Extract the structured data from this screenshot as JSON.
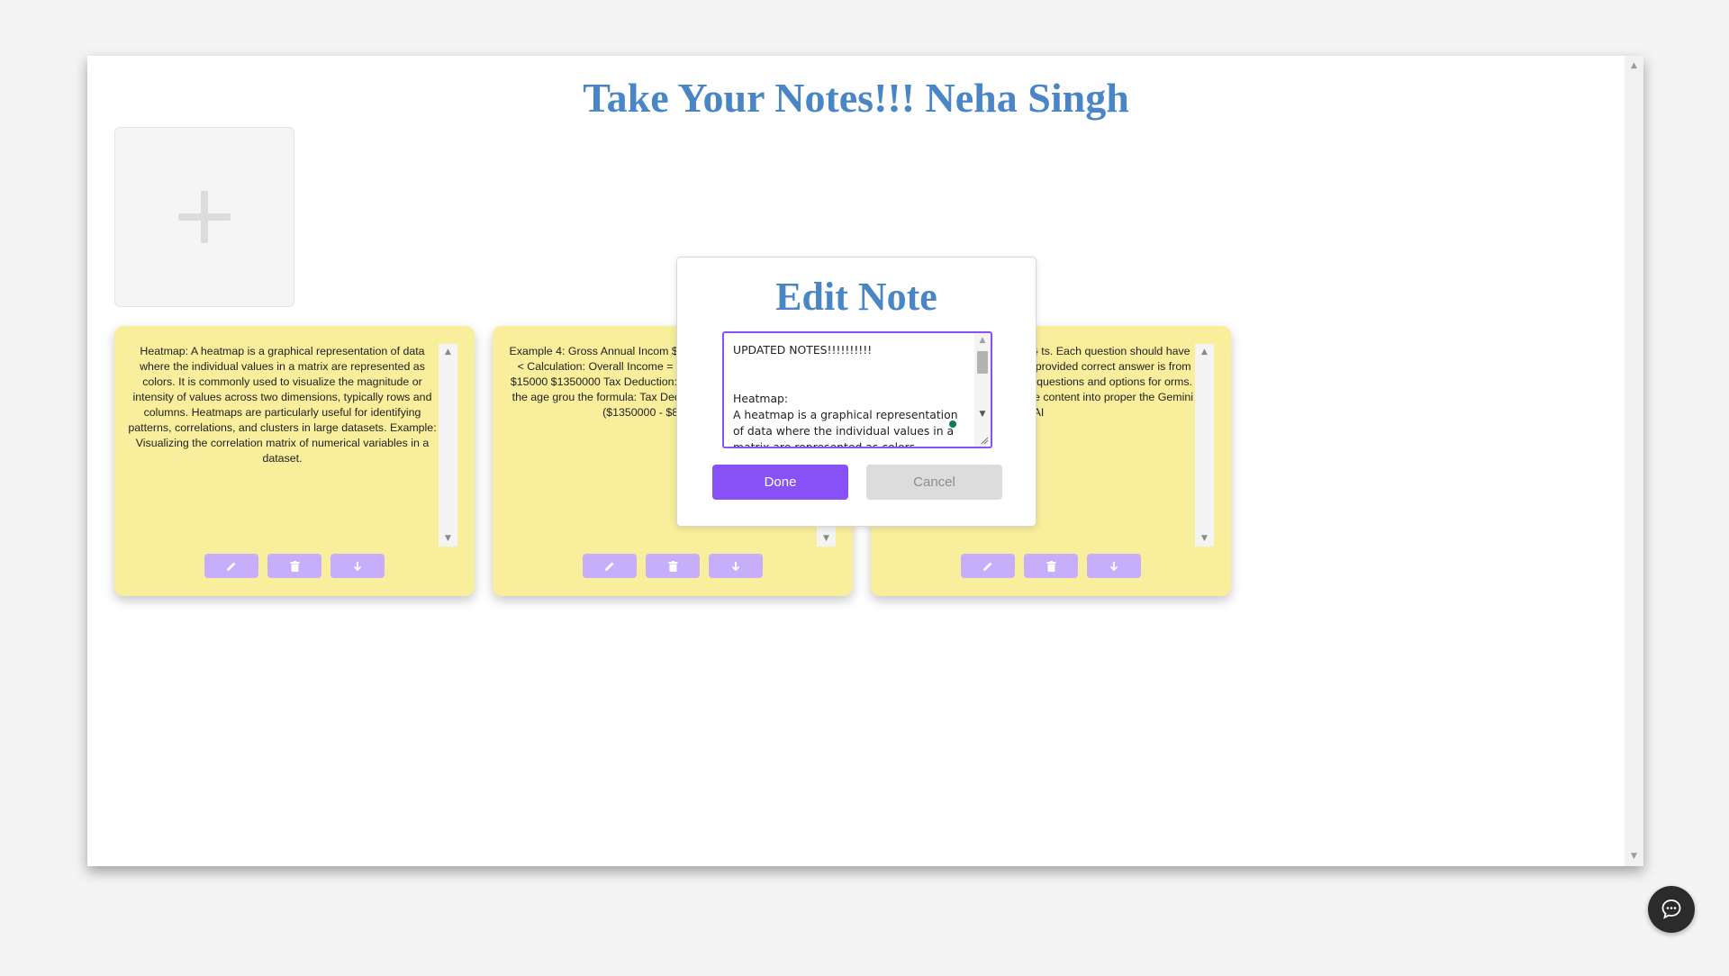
{
  "page": {
    "title": "Take Your Notes!!! Neha Singh"
  },
  "add_note": {
    "icon": "plus-icon"
  },
  "notes": [
    {
      "text": "Heatmap: A heatmap is a graphical representation of data where the individual values in a matrix are represented as colors. It is commonly used to visualize the magnitude or intensity of values across two dimensions, typically rows and columns. Heatmaps are particularly useful for identifying patterns, correlations, and clusters in large datasets. Example: Visualizing the correlation matrix of numerical variables in a dataset."
    },
    {
      "text": "Example 4: Gross Annual Incom $50000 Age Group: ≥ 40 but < Calculation: Overall Income = Gr Income - Deductions = $15000 $1350000 Tax Deduction: Since t than $800,000 and the age grou the formula: Tax Deduction = $800,000) = 0.4 * ($1350000 - $8 $22000"
    },
    {
      "text": "ment questions for the ${topic} ts. Each question should have options per question) with the provided correct answer is from utside Assign 2 marks to each questions and options for orms. Output the response in e above content into proper the Gemini AI"
    }
  ],
  "note_actions": {
    "edit_icon": "pencil-icon",
    "delete_icon": "trash-icon",
    "download_icon": "arrow-down-icon"
  },
  "modal": {
    "title": "Edit Note",
    "textarea_value": "UPDATED NOTES!!!!!!!!!!\n\n\nHeatmap:\nA heatmap is a graphical representation of data where the individual values in a matrix are represented as colors.",
    "done_label": "Done",
    "cancel_label": "Cancel"
  },
  "chat": {
    "icon": "chat-bubble-icon"
  },
  "colors": {
    "title": "#4a86c5",
    "note_bg": "#f8ee9c",
    "note_button": "#c7aefc",
    "primary": "#8751f5"
  }
}
